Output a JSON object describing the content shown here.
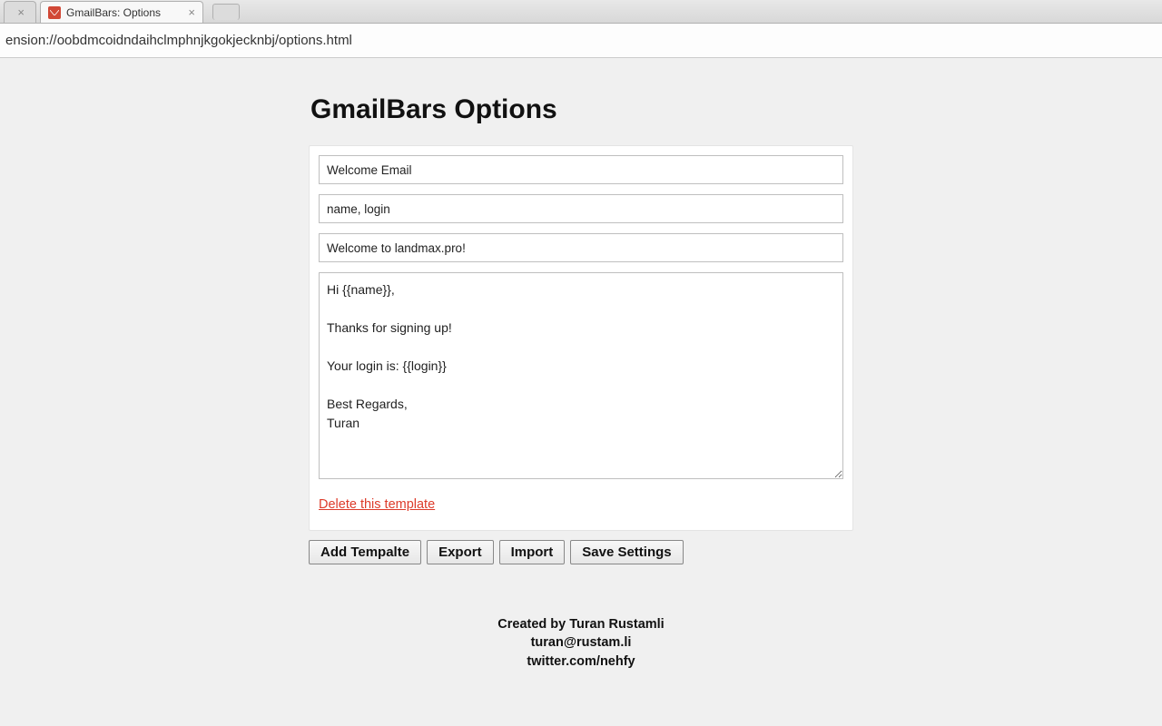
{
  "browser": {
    "inactive_tab_close": "×",
    "active_tab_title": "GmailBars: Options",
    "active_tab_close": "×",
    "address": "ension://oobdmcoidndaihclmphnjkgokjecknbj/options.html"
  },
  "page": {
    "title": "GmailBars Options"
  },
  "template": {
    "name": "Welcome Email",
    "variables": "name, login",
    "subject": "Welcome to landmax.pro!",
    "body": "Hi {{name}},\n\nThanks for signing up!\n\nYour login is: {{login}}\n\nBest Regards,\nTuran",
    "delete_label": "Delete this template"
  },
  "buttons": {
    "add": "Add Tempalte",
    "export": "Export",
    "import": "Import",
    "save": "Save Settings"
  },
  "footer": {
    "line1": "Created by Turan Rustamli",
    "line2": "turan@rustam.li",
    "line3": "twitter.com/nehfy"
  }
}
